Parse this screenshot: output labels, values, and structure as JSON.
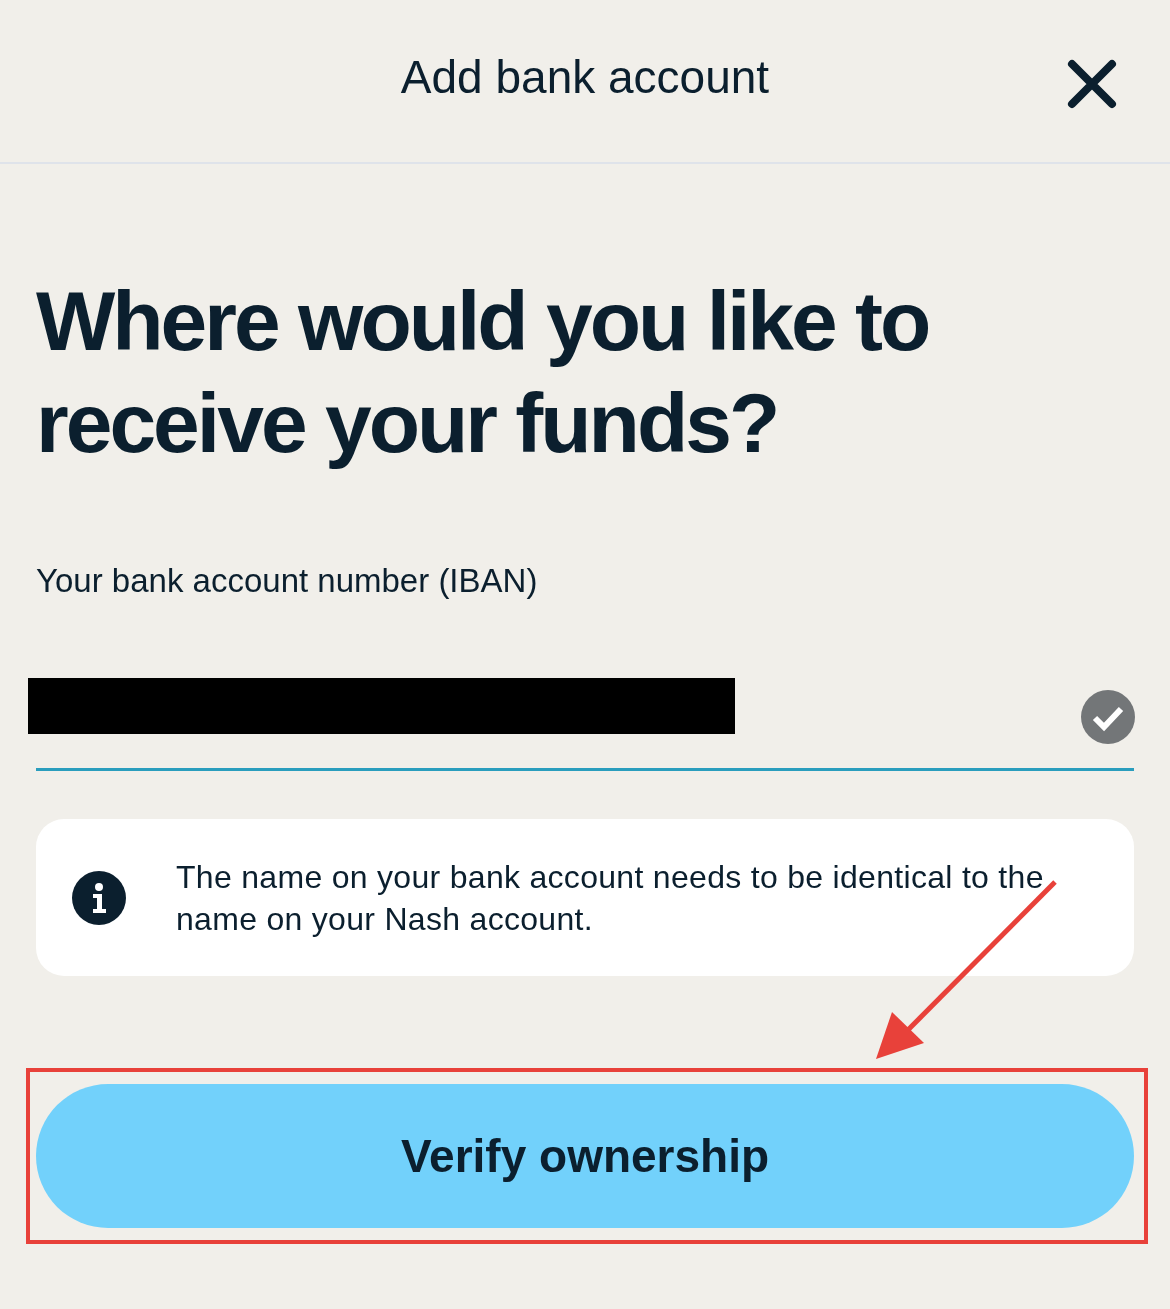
{
  "header": {
    "title": "Add bank account"
  },
  "heading": "Where would you like to receive your funds?",
  "iban_field": {
    "label": "Your bank account number (IBAN)",
    "redacted": true,
    "valid": true
  },
  "notice": {
    "text": "The name on your bank account needs to be identical to the name on your Nash account."
  },
  "primary_button": {
    "label": "Verify ownership",
    "highlighted": true
  }
}
